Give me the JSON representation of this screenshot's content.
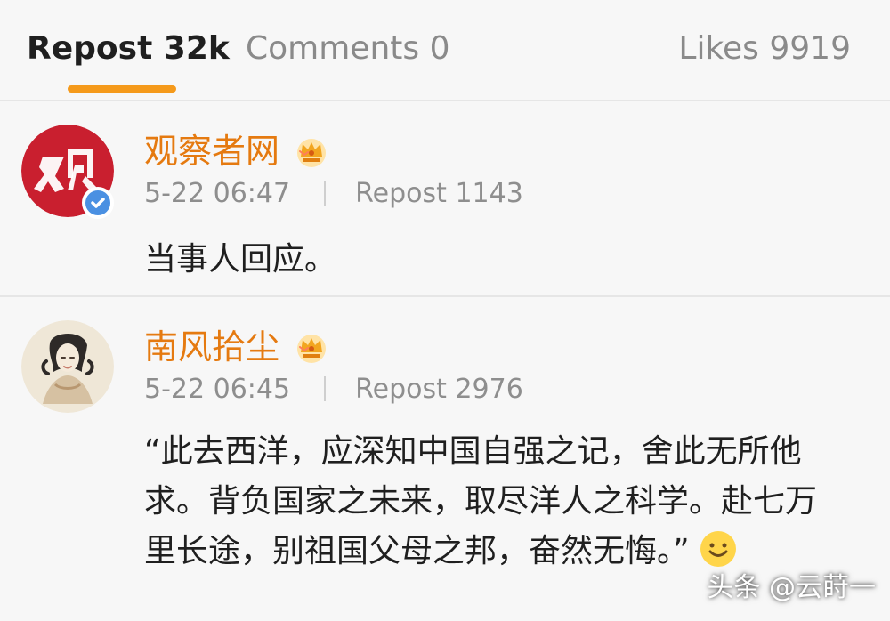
{
  "tabs": {
    "repost": "Repost 32k",
    "comments": "Comments 0",
    "likes": "Likes 9919"
  },
  "posts": [
    {
      "username": "观察者网",
      "time": "5-22 06:47",
      "repost": "Repost 1143",
      "content": "当事人回应。",
      "avatar_icon": "guancha-logo-icon",
      "badge_icon": "verified-badge-icon",
      "crown_icon": "vip-crown-icon"
    },
    {
      "username": "南风拾尘",
      "time": "5-22 06:45",
      "repost": "Repost 2976",
      "content": "“此去西洋，应深知中国自强之记，舍此无所他求。背负国家之未来，取尽洋人之科学。赴七万里长途，别祖国父母之邦，奋然无悔。”",
      "avatar_icon": "portrait-avatar-icon",
      "crown_icon": "vip-crown-icon",
      "emoji_icon": "smile-emoji-icon"
    }
  ],
  "watermark": "头条 @云莳一",
  "colors": {
    "accent": "#f59a1b",
    "username": "#e57a10",
    "background": "#f7f7f7",
    "verified": "#4a90e2",
    "logo_red": "#c91f2f"
  }
}
